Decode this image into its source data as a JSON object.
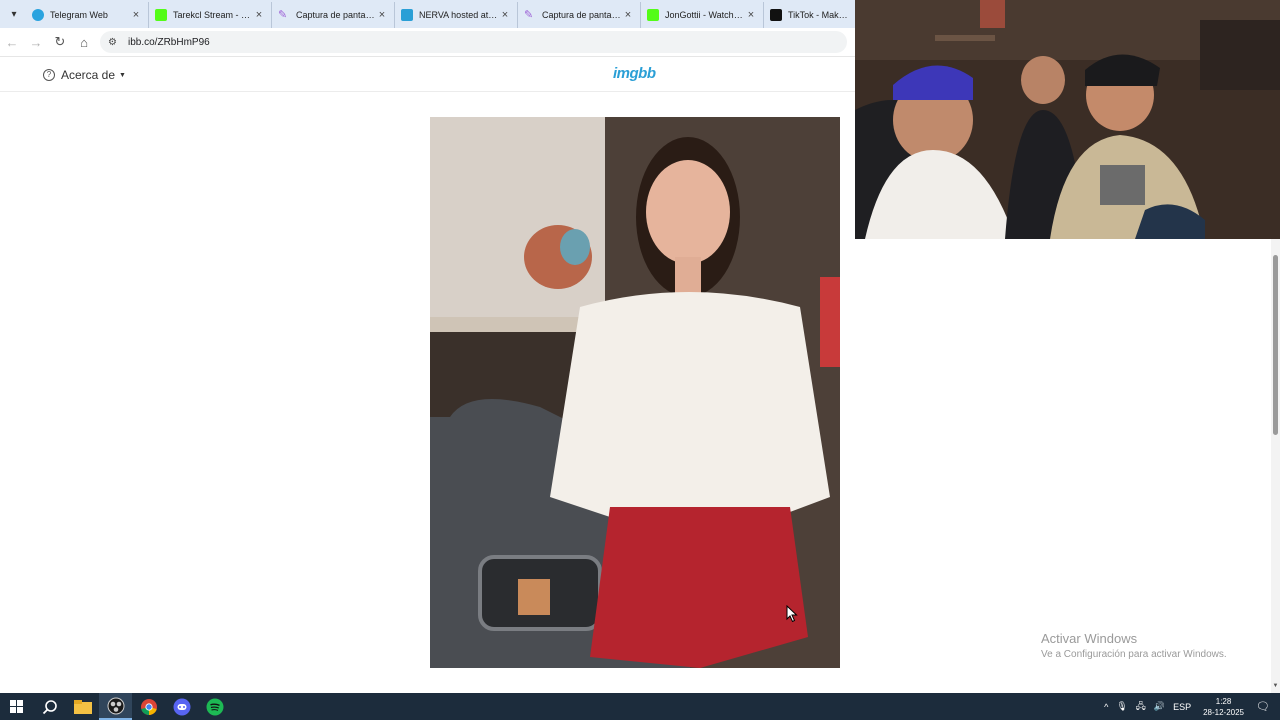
{
  "browser": {
    "tabs": [
      {
        "title": "Telegram Web",
        "fav_color": "#2aa3df"
      },
      {
        "title": "Tarekcl Stream - Watch",
        "fav_color": "#53fc18"
      },
      {
        "title": "Captura de pantalla de",
        "fav_color": "#9c5fd6"
      },
      {
        "title": "NERVA hosted at ImgBB",
        "fav_color": "#2a9fd6"
      },
      {
        "title": "Captura de pantalla de",
        "fav_color": "#9c5fd6"
      },
      {
        "title": "JonGottii - Watch clips",
        "fav_color": "#53fc18"
      },
      {
        "title": "TikTok - Make Your Day",
        "fav_color": "#111111"
      }
    ],
    "url": "ibb.co/ZRbHmP96"
  },
  "site": {
    "about_label": "Acerca de",
    "logo": "imgbb"
  },
  "watermark": {
    "line1": "Activar Windows",
    "line2": "Ve a Configuración para activar Windows."
  },
  "taskbar": {
    "language": "ESP",
    "time": "1:28",
    "date": "28-12-2025"
  },
  "colors": {
    "taskbar": "#1c2c3c",
    "tabstrip": "#dfe9f6",
    "logo": "#2a9fd6"
  }
}
